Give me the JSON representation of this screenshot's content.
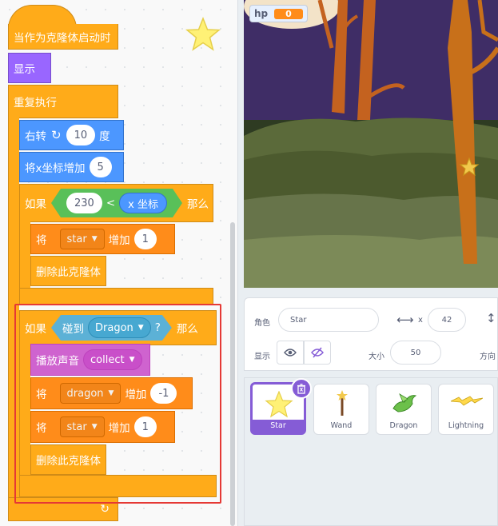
{
  "code": {
    "hat_label": "当作为克隆体启动时",
    "show_label": "显示",
    "forever_label": "重复执行",
    "turn": {
      "label": "右转",
      "value": "10",
      "unit": "度"
    },
    "change_x": {
      "label": "将x坐标增加",
      "value": "5"
    },
    "if1": {
      "label": "如果",
      "left_value": "230",
      "operator": "<",
      "reporter": "x 坐标",
      "then": "那么"
    },
    "change_var1": {
      "prefix": "将",
      "var": "star",
      "action": "增加",
      "value": "1"
    },
    "delete_clone_1": "删除此克隆体",
    "if2": {
      "label": "如果",
      "touching": "碰到",
      "target": "Dragon",
      "q": "?",
      "then": "那么"
    },
    "play_sound": {
      "label": "播放声音",
      "sound": "collect"
    },
    "change_var2": {
      "prefix": "将",
      "var": "dragon",
      "action": "增加",
      "value": "-1"
    },
    "change_var3": {
      "prefix": "将",
      "var": "star",
      "action": "增加",
      "value": "1"
    },
    "delete_clone_2": "删除此克隆体"
  },
  "stage": {
    "monitor_label": "hp",
    "monitor_value": "0"
  },
  "sprite_info": {
    "sprite_label": "角色",
    "sprite_name": "Star",
    "x_label": "x",
    "x_value": "42",
    "show_label": "显示",
    "size_label": "大小",
    "size_value": "50",
    "direction_label": "方向"
  },
  "sprites": [
    {
      "name": "Star",
      "selected": true
    },
    {
      "name": "Wand",
      "selected": false
    },
    {
      "name": "Dragon",
      "selected": false
    },
    {
      "name": "Lightning",
      "selected": false
    }
  ],
  "colors": {
    "control": "#ffab19",
    "looks": "#9966ff",
    "motion": "#4c97ff",
    "variables": "#ff8c1a",
    "sound": "#cf63cf",
    "sensing": "#5cb1d6",
    "operators": "#59c059",
    "selection": "#e53935",
    "sprite_selected": "#855cd6"
  }
}
